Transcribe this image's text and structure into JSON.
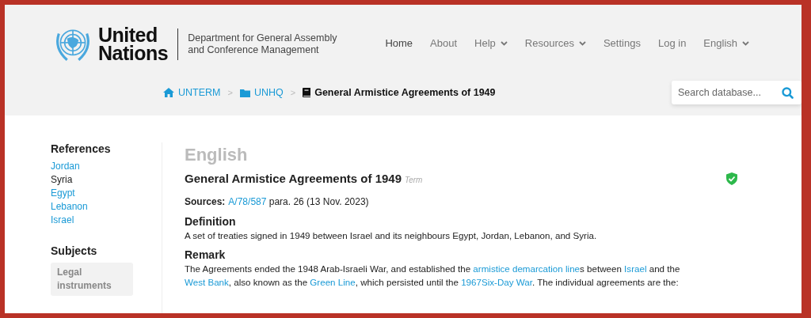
{
  "header": {
    "logo_text": [
      "United",
      "Nations"
    ],
    "department": [
      "Department for General Assembly",
      "and Conference Management"
    ],
    "nav": [
      {
        "label": "Home",
        "selected": true,
        "dropdown": false
      },
      {
        "label": "About",
        "selected": false,
        "dropdown": false
      },
      {
        "label": "Help",
        "selected": false,
        "dropdown": true
      },
      {
        "label": "Resources",
        "selected": false,
        "dropdown": true
      },
      {
        "label": "Settings",
        "selected": false,
        "dropdown": false
      },
      {
        "label": "Log in",
        "selected": false,
        "dropdown": false
      },
      {
        "label": "English",
        "selected": false,
        "dropdown": true
      }
    ]
  },
  "breadcrumb": [
    {
      "label": "UNTERM",
      "current": false
    },
    {
      "label": "UNHQ",
      "current": false
    },
    {
      "label": "General Armistice Agreements of 1949",
      "current": true
    }
  ],
  "breadcrumb_separator": ">",
  "search": {
    "placeholder": "Search database..."
  },
  "sidebar": {
    "references_title": "References",
    "references": [
      {
        "label": "Jordan",
        "link": true
      },
      {
        "label": "Syria",
        "link": false
      },
      {
        "label": "Egypt",
        "link": true
      },
      {
        "label": "Lebanon",
        "link": true
      },
      {
        "label": "Israel",
        "link": true
      }
    ],
    "subjects_title": "Subjects",
    "subjects": [
      "Legal instruments"
    ]
  },
  "main": {
    "language": "English",
    "term": "General Armistice Agreements of 1949",
    "term_type": "Term",
    "verified": true,
    "sources_label": "Sources:",
    "sources": [
      {
        "kind": "link",
        "text": "A/78/587"
      },
      {
        "kind": "text",
        "text": " para. 26 (13 Nov. 2023)"
      }
    ],
    "definition_title": "Definition",
    "definition": "A set of treaties signed in 1949 between Israel and its neighbours Egypt, Jordan, Lebanon, and Syria.",
    "remark_title": "Remark",
    "remark": [
      {
        "kind": "text",
        "text": "The Agreements ended the 1948 Arab-Israeli War, and established the "
      },
      {
        "kind": "link",
        "text": "armistice demarcation line"
      },
      {
        "kind": "text",
        "text": "s between "
      },
      {
        "kind": "link",
        "text": "Israel"
      },
      {
        "kind": "text",
        "text": " and the "
      },
      {
        "kind": "link",
        "text": "West Bank"
      },
      {
        "kind": "text",
        "text": ", also known as the "
      },
      {
        "kind": "link",
        "text": "Green Line"
      },
      {
        "kind": "text",
        "text": ", which persisted until the "
      },
      {
        "kind": "link",
        "text": "1967Six-Day War"
      },
      {
        "kind": "text",
        "text": ". The individual agreements are the:"
      }
    ]
  }
}
